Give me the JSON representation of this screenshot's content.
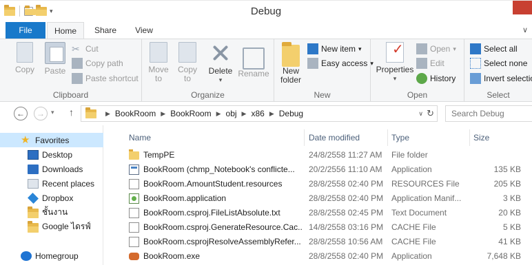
{
  "window": {
    "title": "Debug"
  },
  "ribbon_tabs": [
    {
      "label": "File"
    },
    {
      "label": "Home"
    },
    {
      "label": "Share"
    },
    {
      "label": "View"
    }
  ],
  "ribbon": {
    "clipboard": {
      "label": "Clipboard",
      "copy": "Copy",
      "paste": "Paste",
      "cut": "Cut",
      "copy_path": "Copy path",
      "paste_shortcut": "Paste shortcut"
    },
    "organize": {
      "label": "Organize",
      "move_to_line1": "Move",
      "move_to_line2": "to",
      "copy_to_line1": "Copy",
      "copy_to_line2": "to",
      "delete": "Delete",
      "rename": "Rename"
    },
    "new": {
      "label": "New",
      "new_folder_line1": "New",
      "new_folder_line2": "folder",
      "new_item": "New item",
      "easy_access": "Easy access"
    },
    "open": {
      "label": "Open",
      "properties": "Properties",
      "open": "Open",
      "edit": "Edit",
      "history": "History"
    },
    "select": {
      "label": "Select",
      "select_all": "Select all",
      "select_none": "Select none",
      "invert_selection": "Invert selection"
    }
  },
  "address": {
    "crumbs": [
      "BookRoom",
      "BookRoom",
      "obj",
      "x86",
      "Debug"
    ]
  },
  "search": {
    "placeholder": "Search Debug"
  },
  "nav_pane": {
    "favorites": "Favorites",
    "items": [
      "Desktop",
      "Downloads",
      "Recent places",
      "Dropbox",
      "ชั้นงาน",
      "Google ไดรฟ์"
    ],
    "homegroup": "Homegroup"
  },
  "file_list": {
    "columns": [
      "Name",
      "Date modified",
      "Type",
      "Size"
    ],
    "rows": [
      {
        "name": "TempPE",
        "date": "24/8/2558 11:27 AM",
        "type": "File folder",
        "size": "",
        "icon": "folder-icon"
      },
      {
        "name": "BookRoom (chmp_Notebook's conflicte...",
        "date": "20/2/2556 11:10 AM",
        "type": "Application",
        "size": "135 KB",
        "icon": "application-icon"
      },
      {
        "name": "BookRoom.AmountStudent.resources",
        "date": "28/8/2558 02:40 PM",
        "type": "RESOURCES File",
        "size": "205 KB",
        "icon": "document-icon"
      },
      {
        "name": "BookRoom.application",
        "date": "28/8/2558 02:40 PM",
        "type": "Application Manif...",
        "size": "3 KB",
        "icon": "clickonce-icon"
      },
      {
        "name": "BookRoom.csproj.FileListAbsolute.txt",
        "date": "28/8/2558 02:45 PM",
        "type": "Text Document",
        "size": "20 KB",
        "icon": "document-icon"
      },
      {
        "name": "BookRoom.csproj.GenerateResource.Cac...",
        "date": "14/8/2558 03:16 PM",
        "type": "CACHE File",
        "size": "5 KB",
        "icon": "document-icon"
      },
      {
        "name": "BookRoom.csprojResolveAssemblyRefer...",
        "date": "28/8/2558 10:56 AM",
        "type": "CACHE File",
        "size": "41 KB",
        "icon": "document-icon"
      },
      {
        "name": "BookRoom.exe",
        "date": "28/8/2558 02:40 PM",
        "type": "Application",
        "size": "7,648 KB",
        "icon": "exe-icon"
      }
    ]
  }
}
